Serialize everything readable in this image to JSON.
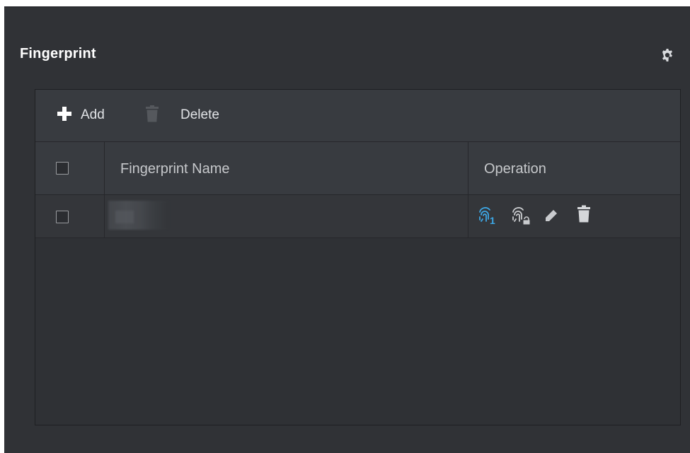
{
  "panel": {
    "title": "Fingerprint"
  },
  "toolbar": {
    "add_label": "Add",
    "delete_label": "Delete"
  },
  "table": {
    "columns": [
      "Fingerprint Name",
      "Operation"
    ],
    "rows": [
      {
        "name": "",
        "checked": false,
        "operations": [
          "fingerprint-duress-icon",
          "fingerprint-lock-icon",
          "edit-icon",
          "delete-icon"
        ]
      }
    ]
  },
  "colors": {
    "panel_bg": "#303236",
    "toolbar_bg": "#383b40",
    "accent_blue": "#3da8e6",
    "icon_gray": "#c9cbce"
  }
}
